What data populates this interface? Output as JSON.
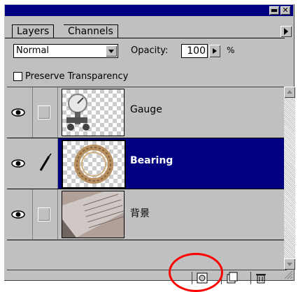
{
  "window": {
    "minimize_label": "▬",
    "close_label": "✕"
  },
  "tabs": [
    {
      "label": "Layers",
      "active": true
    },
    {
      "label": "Channels",
      "active": false
    }
  ],
  "options": {
    "blend_mode": "Normal",
    "opacity_label": "Opacity:",
    "opacity_value": "100",
    "percent": "%"
  },
  "preserve": {
    "label": "Preserve Transparency",
    "checked": false
  },
  "layers": [
    {
      "name": "Gauge",
      "visible": true,
      "selected": false,
      "brush": false
    },
    {
      "name": "Bearing",
      "visible": true,
      "selected": true,
      "brush": true
    },
    {
      "name": "背景",
      "visible": true,
      "selected": false,
      "brush": false
    }
  ],
  "bottom_buttons": [
    "add-layer-mask-icon",
    "new-layer-icon",
    "trash-icon"
  ],
  "colors": {
    "title_bar": "#000080",
    "selected_row": "#000080",
    "panel": "#c0c0c0",
    "highlight_circle": "#ff0000"
  }
}
